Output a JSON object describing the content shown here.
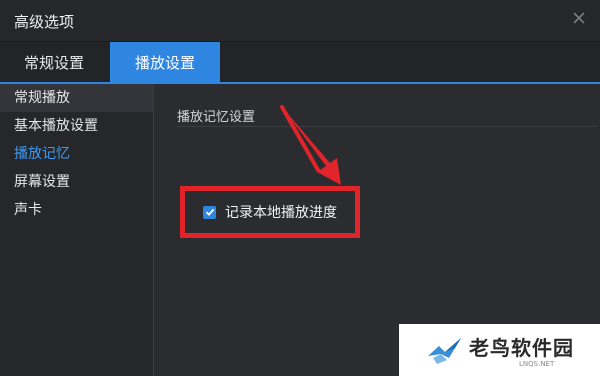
{
  "window": {
    "title": "高级选项"
  },
  "tabs": [
    {
      "label": "常规设置",
      "active": false
    },
    {
      "label": "播放设置",
      "active": true
    }
  ],
  "sidebar": {
    "items": [
      {
        "label": "常规播放"
      },
      {
        "label": "基本播放设置"
      },
      {
        "label": "播放记忆",
        "active": true
      },
      {
        "label": "屏幕设置"
      },
      {
        "label": "声卡"
      }
    ]
  },
  "content": {
    "section_title": "播放记忆设置",
    "checkbox": {
      "label": "记录本地播放进度",
      "checked": true
    }
  },
  "annotation": {
    "highlight_color": "#e0242a"
  },
  "colors": {
    "accent": "#2f86e0",
    "active_text": "#3d9bf5",
    "background": "#2b2c30"
  },
  "watermark": {
    "text": "老鸟软件园",
    "subtext": "LNQS.NET"
  }
}
